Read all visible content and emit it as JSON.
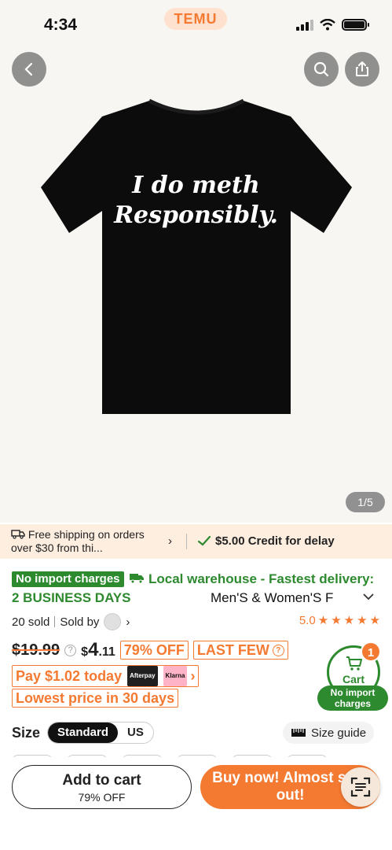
{
  "status_bar": {
    "time": "4:34",
    "brand": "TEMU"
  },
  "gallery": {
    "shirt_line1": "I do meth",
    "shirt_line2": "Responsibly.",
    "counter": "1/5"
  },
  "shipping": {
    "free_text": "Free shipping on orders over $30 from thi...",
    "credit_text": "$5.00 Credit for delay"
  },
  "info": {
    "no_import_badge": "No import charges",
    "local_warehouse": "Local warehouse - Fastest delivery: 2 BUSINESS DAYS",
    "product_title": "Men'S & Women'S F",
    "sold": "20 sold",
    "sold_by": "Sold by",
    "rating": "5.0"
  },
  "price": {
    "old": "$19.99",
    "currency": "$",
    "main": "4",
    "cents": ".11",
    "discount": "79% OFF",
    "stock": "LAST FEW",
    "pay_today": "Pay $1.02 today",
    "afterpay": "Afterpay",
    "klarna": "Klarna",
    "lowest": "Lowest price in 30 days"
  },
  "cart": {
    "label": "Cart",
    "count": "1",
    "pill": "No import charges"
  },
  "size": {
    "label": "Size",
    "tabs": [
      "Standard",
      "US"
    ],
    "guide": "Size guide"
  },
  "actions": {
    "add_to_cart": "Add to cart",
    "add_to_cart_sub": "79% OFF",
    "buy_now": "Buy now! Almost sold out!"
  },
  "colors": {
    "accent": "#f47a32",
    "green": "#2d8a2f"
  }
}
